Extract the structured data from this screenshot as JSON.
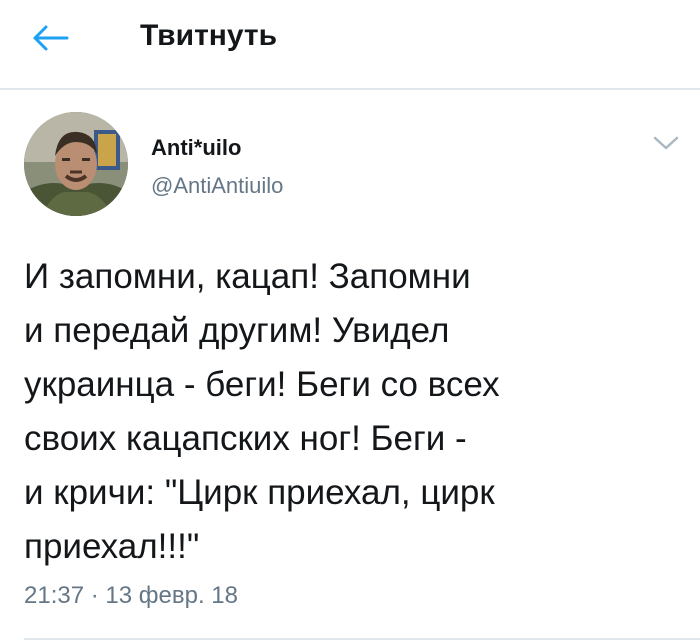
{
  "header": {
    "title": "Твитнуть",
    "back_icon": "arrow-left-icon"
  },
  "tweet": {
    "author": {
      "display_name": "Anti*uilo",
      "handle": "@AntiAntiuilo",
      "avatar": "profile-photo"
    },
    "menu_icon": "chevron-down-icon",
    "text": "И запомни, кацап! Запомни\nи передай другим! Увидел\nукраинца - беги! Беги со всех\nсвоих кацапских ног! Беги -\nи кричи: \"Цирк приехал, цирк\nприехал!!!\"",
    "timestamp": "21:37 · 13 февр. 18"
  },
  "colors": {
    "accent": "#1da1f2",
    "text_primary": "#14171a",
    "text_secondary": "#657786",
    "divider": "#e1e8ed"
  }
}
